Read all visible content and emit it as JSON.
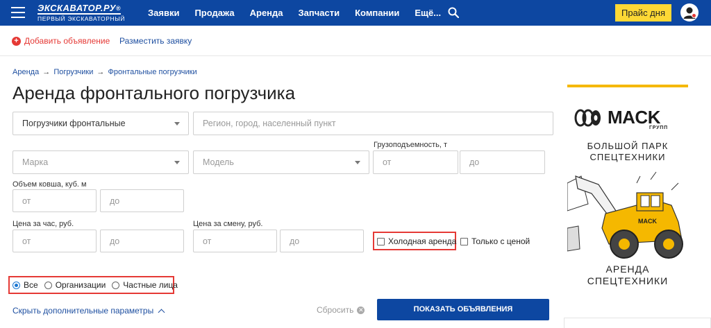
{
  "header": {
    "logo_main": "ЭКСКАВАТОР.РУ",
    "logo_sup": "®",
    "logo_sub": "ПЕРВЫЙ ЭКСКАВАТОРНЫЙ",
    "nav": [
      "Заявки",
      "Продажа",
      "Аренда",
      "Запчасти",
      "Компании",
      "Ещё..."
    ],
    "price_button": "Прайс дня",
    "brand_color": "#0d47a1",
    "accent_color": "#fdd835"
  },
  "subbar": {
    "add_listing": "Добавить объявление",
    "post_request": "Разместить заявку"
  },
  "breadcrumb": [
    "Аренда",
    "Погрузчики",
    "Фронтальные погрузчики"
  ],
  "breadcrumb_sep": "→",
  "page_title": "Аренда фронтального погрузчика",
  "filters": {
    "category_value": "Погрузчики фронтальные",
    "region_placeholder": "Регион, город, населенный пункт",
    "brand_placeholder": "Марка",
    "model_placeholder": "Модель",
    "capacity_label": "Грузоподъемность, т",
    "bucket_label": "Объем ковша, куб. м",
    "hour_price_label": "Цена за час, руб.",
    "shift_price_label": "Цена за смену, руб.",
    "from_placeholder": "от",
    "to_placeholder": "до",
    "cold_rent": "Холодная аренда",
    "with_price": "Только с ценой",
    "seller_options": [
      "Все",
      "Организации",
      "Частные лица"
    ],
    "seller_selected": "Все"
  },
  "actions": {
    "hide_params": "Скрыть дополнительные параметры",
    "reset": "Сбросить",
    "show_listings": "ПОКАЗАТЬ ОБЪЯВЛЕНИЯ"
  },
  "ad": {
    "brand": "MACK",
    "brand_sub": "ГРУПП",
    "line1": "БОЛЬШОЙ ПАРК",
    "line2": "СПЕЦТЕХНИКИ",
    "bottom1": "АРЕНДА",
    "bottom2": "СПЕЦТЕХНИКИ",
    "accent_color": "#f5b800"
  }
}
